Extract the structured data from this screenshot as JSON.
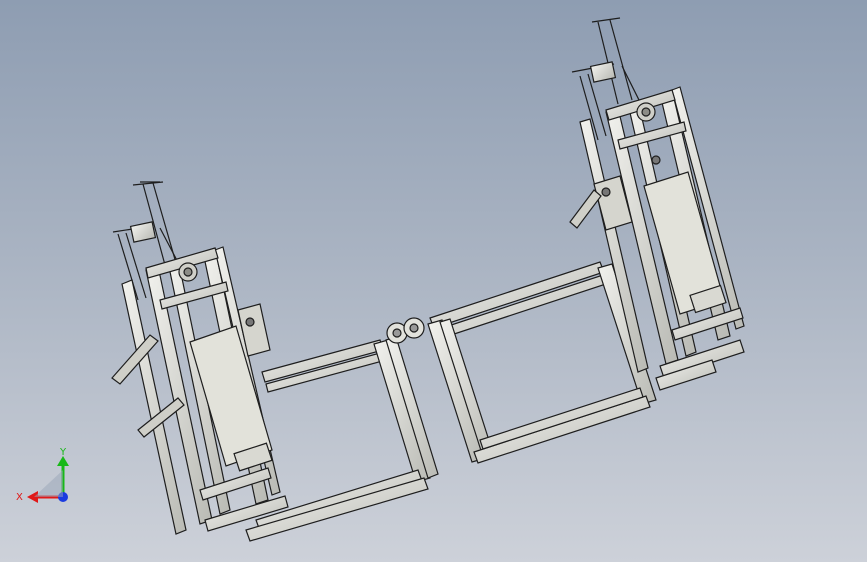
{
  "viewport": {
    "triad": {
      "x_label": "X",
      "y_label": "Y",
      "colors": {
        "x": "#e01818",
        "y": "#18b818",
        "z": "#1a3be0"
      }
    },
    "model": {
      "frame_color": "#e6e6e2",
      "edge_color": "#1e1e1e",
      "panel_color": "#dcdcd4"
    }
  }
}
